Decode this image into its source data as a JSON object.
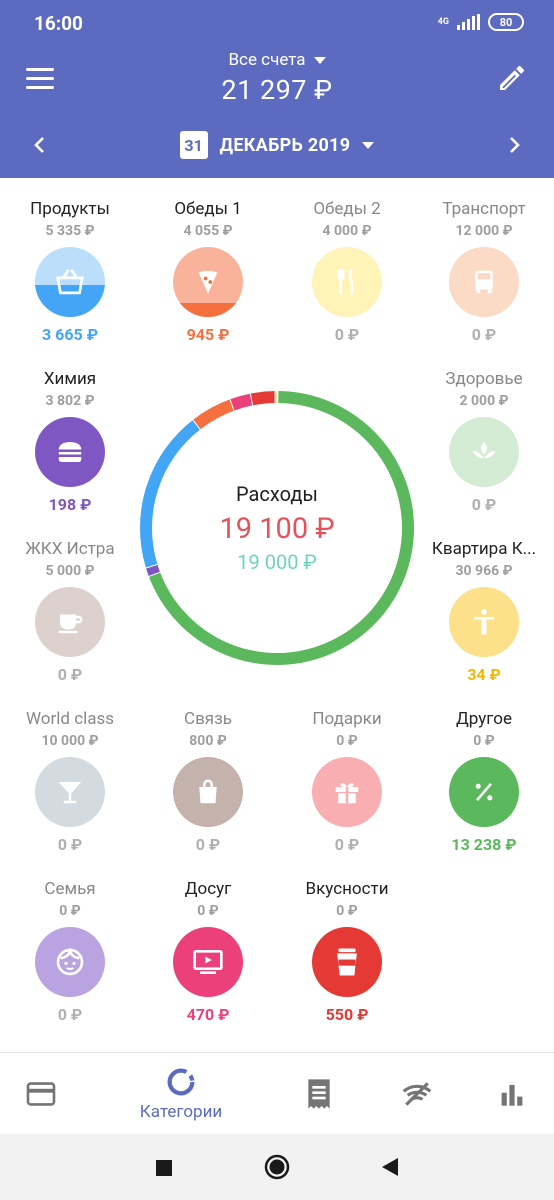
{
  "status": {
    "time": "16:00",
    "network": "4G",
    "battery": "80"
  },
  "header": {
    "account_title": "Все счета",
    "account_total": "21 297 ₽",
    "calendar_day": "31",
    "month": "ДЕКАБРЬ 2019"
  },
  "summary": {
    "title": "Расходы",
    "expenses": "19 100 ₽",
    "income": "19 000 ₽"
  },
  "categories": [
    {
      "name": "Продукты",
      "budget": "5 335 ₽",
      "spent": "3 665 ₽",
      "color": "#42a5f5",
      "icon": "basket-icon"
    },
    {
      "name": "Обеды 1",
      "budget": "4 055 ₽",
      "spent": "945 ₽",
      "color": "#f4703f",
      "icon": "pizza-icon"
    },
    {
      "name": "Обеды 2",
      "budget": "4 000 ₽",
      "spent": "0 ₽",
      "color": "#fff3b0",
      "icon": "fork-knife-icon"
    },
    {
      "name": "Транспорт",
      "budget": "12 000 ₽",
      "spent": "0 ₽",
      "color": "#fbd9c4",
      "icon": "bus-icon"
    },
    {
      "name": "Химия",
      "budget": "3 802 ₽",
      "spent": "198 ₽",
      "color": "#7e57c2",
      "icon": "burger-icon"
    },
    {
      "name": "Здоровье",
      "budget": "2 000 ₽",
      "spent": "0 ₽",
      "color": "#cfe8cf",
      "icon": "lotus-icon"
    },
    {
      "name": "ЖКХ Истра",
      "budget": "5 000 ₽",
      "spent": "0 ₽",
      "color": "#d7ccc8",
      "icon": "cup-icon"
    },
    {
      "name": "Квартира К...",
      "budget": "30 966 ₽",
      "spent": "34 ₽",
      "color": "#fbc02d",
      "icon": "person-icon"
    },
    {
      "name": "World class",
      "budget": "10 000 ₽",
      "spent": "0 ₽",
      "color": "#cfd8dc",
      "icon": "cocktail-icon"
    },
    {
      "name": "Связь",
      "budget": "800 ₽",
      "spent": "0 ₽",
      "color": "#bcaaa4",
      "icon": "bag-icon"
    },
    {
      "name": "Подарки",
      "budget": "0 ₽",
      "spent": "0 ₽",
      "color": "#f8a5a8",
      "icon": "gift-icon"
    },
    {
      "name": "Другое",
      "budget": "0 ₽",
      "spent": "13 238 ₽",
      "color": "#5cb85c",
      "icon": "percent-icon"
    },
    {
      "name": "Семья",
      "budget": "0 ₽",
      "spent": "0 ₽",
      "color": "#b39ddb",
      "icon": "child-face-icon"
    },
    {
      "name": "Досуг",
      "budget": "0 ₽",
      "spent": "470 ₽",
      "color": "#ec407a",
      "icon": "tv-icon"
    },
    {
      "name": "Вкусности",
      "budget": "0 ₽",
      "spent": "550 ₽",
      "color": "#e53935",
      "icon": "coffee-cup-icon"
    }
  ],
  "donut_segments": [
    {
      "category": "Другое",
      "value": 13238,
      "color": "#5cb85c"
    },
    {
      "category": "Химия",
      "value": 198,
      "color": "#7e57c2"
    },
    {
      "category": "Продукты",
      "value": 3665,
      "color": "#42a5f5"
    },
    {
      "category": "Обеды 1",
      "value": 945,
      "color": "#f4703f"
    },
    {
      "category": "Досуг",
      "value": 470,
      "color": "#ec407a"
    },
    {
      "category": "Вкусности",
      "value": 550,
      "color": "#e53935"
    },
    {
      "category": "Квартира К...",
      "value": 34,
      "color": "#fbc02d"
    }
  ],
  "bottom_nav": {
    "items": [
      {
        "icon": "card-icon",
        "label": ""
      },
      {
        "icon": "donut-icon",
        "label": "Категории",
        "active": true
      },
      {
        "icon": "receipt-icon",
        "label": ""
      },
      {
        "icon": "wifi-off-icon",
        "label": ""
      },
      {
        "icon": "bar-chart-icon",
        "label": ""
      }
    ]
  },
  "colors": {
    "header": "#5c6bc0",
    "accent": "#5c6bc0",
    "expense": "#e0545a",
    "income": "#6fd4bf"
  }
}
